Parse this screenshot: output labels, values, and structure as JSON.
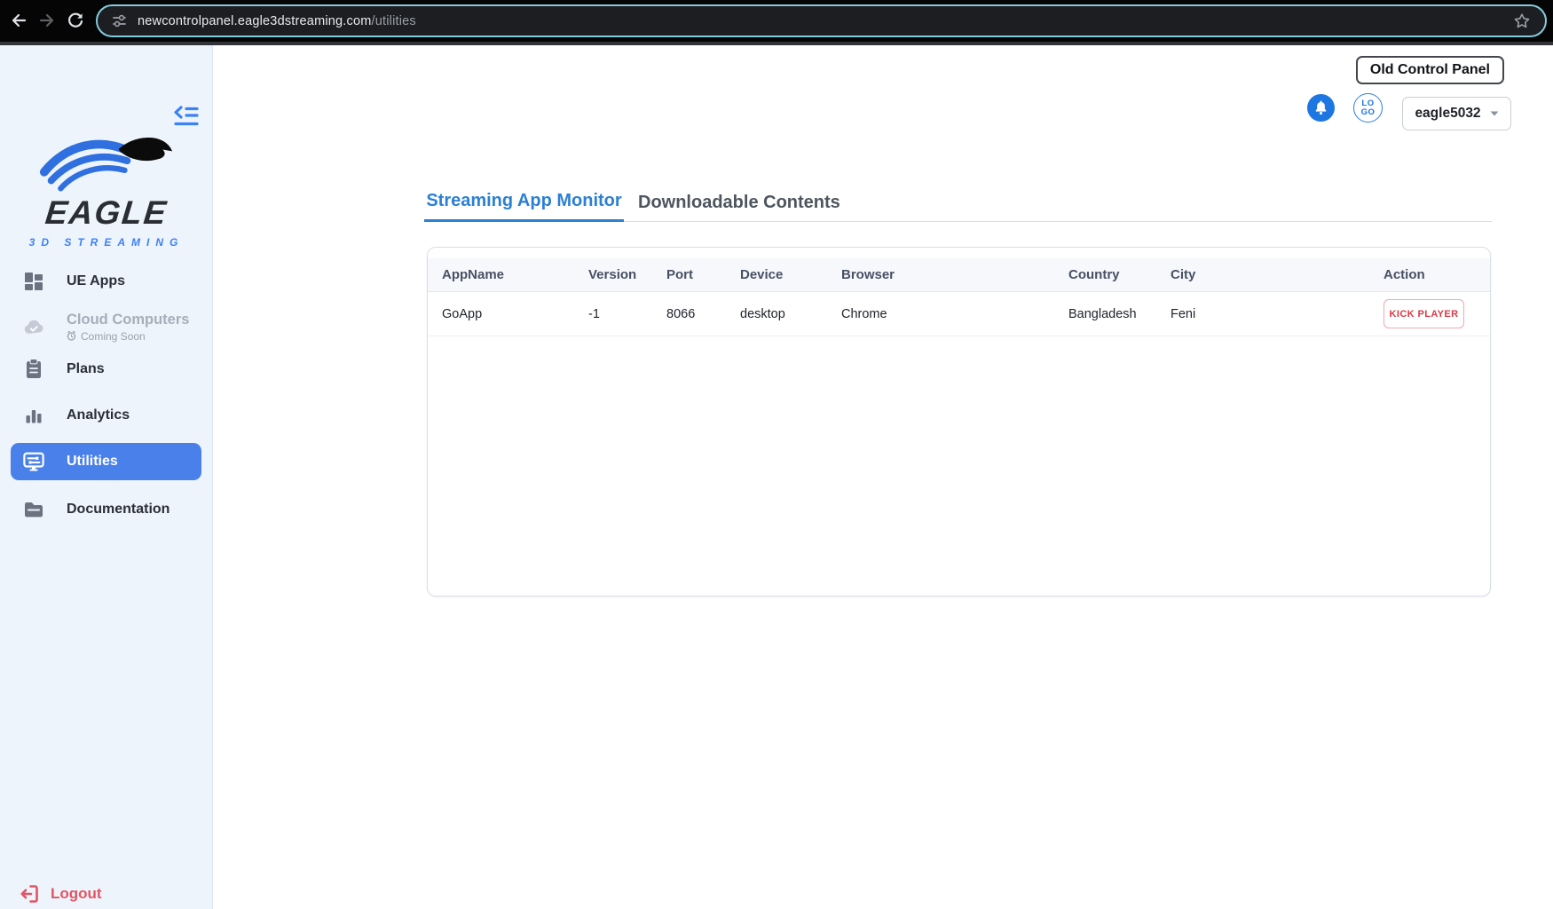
{
  "browser": {
    "url_host": "newcontrolpanel.eagle3dstreaming.com",
    "url_path": "/utilities"
  },
  "brand": {
    "name": "EAGLE",
    "tagline": "3D STREAMING"
  },
  "sidebar": {
    "items": [
      {
        "label": "UE Apps",
        "icon": "grid-dashboard-icon",
        "state": "default"
      },
      {
        "label": "Cloud Computers",
        "sublabel": "Coming Soon",
        "icon": "cloud-check-icon",
        "state": "disabled"
      },
      {
        "label": "Plans",
        "icon": "clipboard-icon",
        "state": "default"
      },
      {
        "label": "Analytics",
        "icon": "bar-chart-icon",
        "state": "default"
      },
      {
        "label": "Utilities",
        "icon": "screen-sliders-icon",
        "state": "active"
      },
      {
        "label": "Documentation",
        "icon": "folder-icon",
        "state": "default"
      }
    ],
    "logout": "Logout"
  },
  "header": {
    "old_panel": "Old Control Panel",
    "logo_line1": "LO",
    "logo_line2": "GO",
    "account": "eagle5032"
  },
  "tabs": [
    {
      "label": "Streaming App Monitor",
      "active": true
    },
    {
      "label": "Downloadable Contents",
      "active": false
    }
  ],
  "table": {
    "columns": [
      "AppName",
      "Version",
      "Port",
      "Device",
      "Browser",
      "Country",
      "City",
      "Action"
    ],
    "rows": [
      {
        "appname": "GoApp",
        "version": "-1",
        "port": "8066",
        "device": "desktop",
        "browser": "Chrome",
        "country": "Bangladesh",
        "city": "Feni",
        "action_label": "KICK PLAYER"
      }
    ]
  },
  "colors": {
    "accent_blue": "#3b82f6",
    "active_item_blue": "#4a80ea",
    "tab_active_blue": "#2c80d4",
    "logout_red": "#e25563",
    "kick_red": "#d93a46",
    "bell_blue": "#1d76e2",
    "url_focus_ring": "#83ccde"
  }
}
